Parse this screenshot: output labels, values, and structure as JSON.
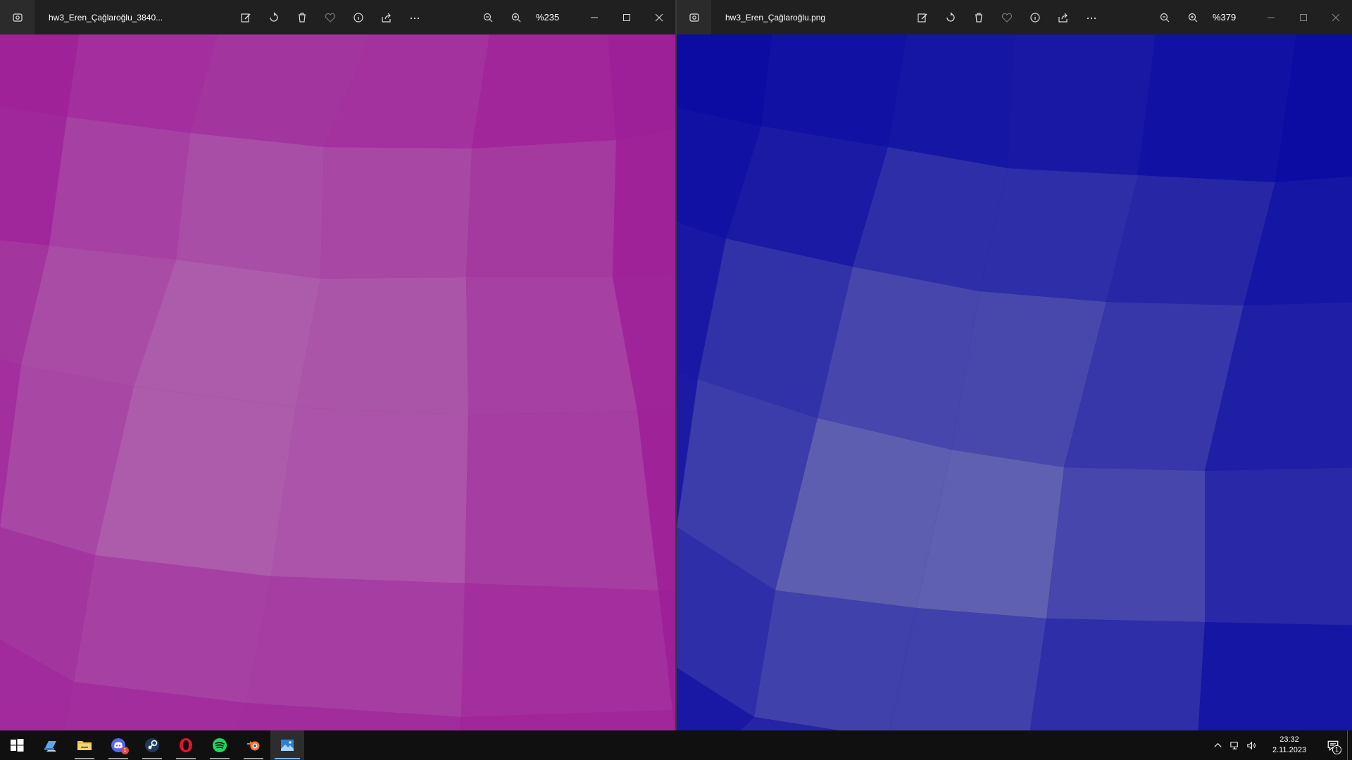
{
  "windows": [
    {
      "title": "hw3_Eren_Çağlaroğlu_3840...",
      "zoom": "%235",
      "focused": true,
      "palette": {
        "base": "#9e1e98",
        "light": "#b06bb0"
      }
    },
    {
      "title": "hw3_Eren_Çağlaroğlu.png",
      "zoom": "%379",
      "focused": false,
      "palette": {
        "base": "#0c0ca2",
        "light": "#6c6cb2"
      }
    }
  ],
  "toolbar_icons": [
    "edit-icon",
    "rotate-icon",
    "delete-icon",
    "favorite-icon",
    "info-icon",
    "share-icon",
    "more-icon"
  ],
  "taskbar": {
    "apps": [
      {
        "name": "start",
        "icon": "windows-icon"
      },
      {
        "name": "desktop-app",
        "icon": "laptop-icon"
      },
      {
        "name": "file-explorer",
        "icon": "folder-icon"
      },
      {
        "name": "discord",
        "icon": "discord-icon",
        "badge": "1"
      },
      {
        "name": "steam",
        "icon": "steam-icon"
      },
      {
        "name": "opera",
        "icon": "opera-icon"
      },
      {
        "name": "spotify",
        "icon": "spotify-icon"
      },
      {
        "name": "blender",
        "icon": "blender-icon"
      },
      {
        "name": "photos",
        "icon": "photos-icon"
      }
    ],
    "clock": {
      "time": "23:32",
      "date": "2.11.2023"
    },
    "notification_count": "1"
  }
}
